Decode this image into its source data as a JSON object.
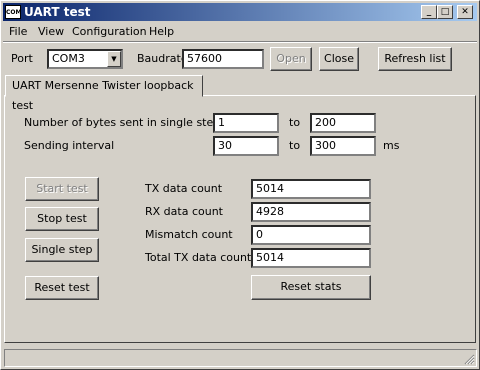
{
  "window": {
    "title": "UART test",
    "app_icon_text": "COM",
    "minimize_icon": "_",
    "maximize_icon": "□",
    "close_icon": "✕"
  },
  "menu": [
    "File",
    "View",
    "Configuration",
    "Help"
  ],
  "toolbar": {
    "port_label": "Port",
    "port_value": "COM3",
    "baudrate_label": "Baudrate",
    "baudrate_value": "57600",
    "open_label": "Open",
    "close_label": "Close",
    "refresh_label": "Refresh list"
  },
  "tab": {
    "label": "UART Mersenne Twister loopback test"
  },
  "settings": {
    "bytes_label": "Number of bytes sent in single step",
    "bytes_from": "1",
    "to_label": "to",
    "bytes_to": "200",
    "interval_label": "Sending interval",
    "interval_from": "30",
    "interval_to": "300",
    "interval_unit": "ms"
  },
  "buttons": {
    "start": "Start test",
    "stop": "Stop test",
    "single": "Single step",
    "reset_test": "Reset test",
    "reset_stats": "Reset stats"
  },
  "stats": [
    {
      "label": "TX data count",
      "value": "5014"
    },
    {
      "label": "RX data count",
      "value": "4928"
    },
    {
      "label": "Mismatch count",
      "value": "0"
    },
    {
      "label": "Total TX data count",
      "value": "5014"
    }
  ]
}
